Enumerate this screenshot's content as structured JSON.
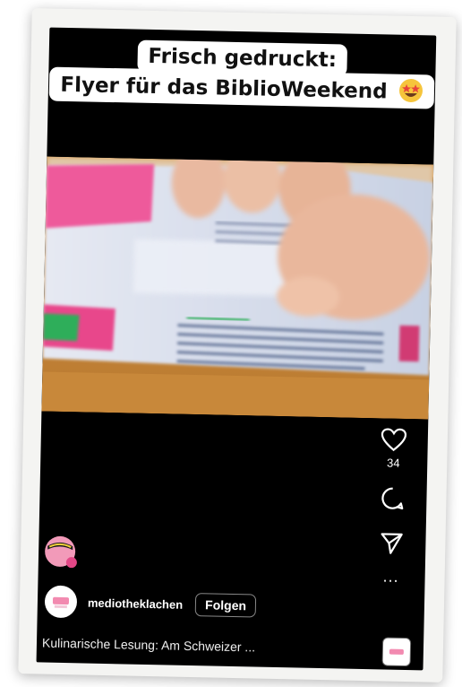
{
  "caption": {
    "line1": "Frisch gedruckt:",
    "line2": "Flyer für das BiblioWeekend"
  },
  "actions": {
    "like_count": "34",
    "more_label": "..."
  },
  "account": {
    "username": "mediotheklachen",
    "follow_label": "Folgen"
  },
  "description": "Kulinarische Lesung: Am Schweizer ...",
  "icons": {
    "like": "heart-icon",
    "comment": "comment-icon",
    "share": "send-icon",
    "more": "more-icon",
    "emoji": "star-struck-emoji-icon"
  },
  "colors": {
    "background": "#000000",
    "text": "#ffffff",
    "flyer_pink": "#e8478b",
    "flyer_green": "#2fae5a",
    "table_wood": "#c98a3c"
  }
}
